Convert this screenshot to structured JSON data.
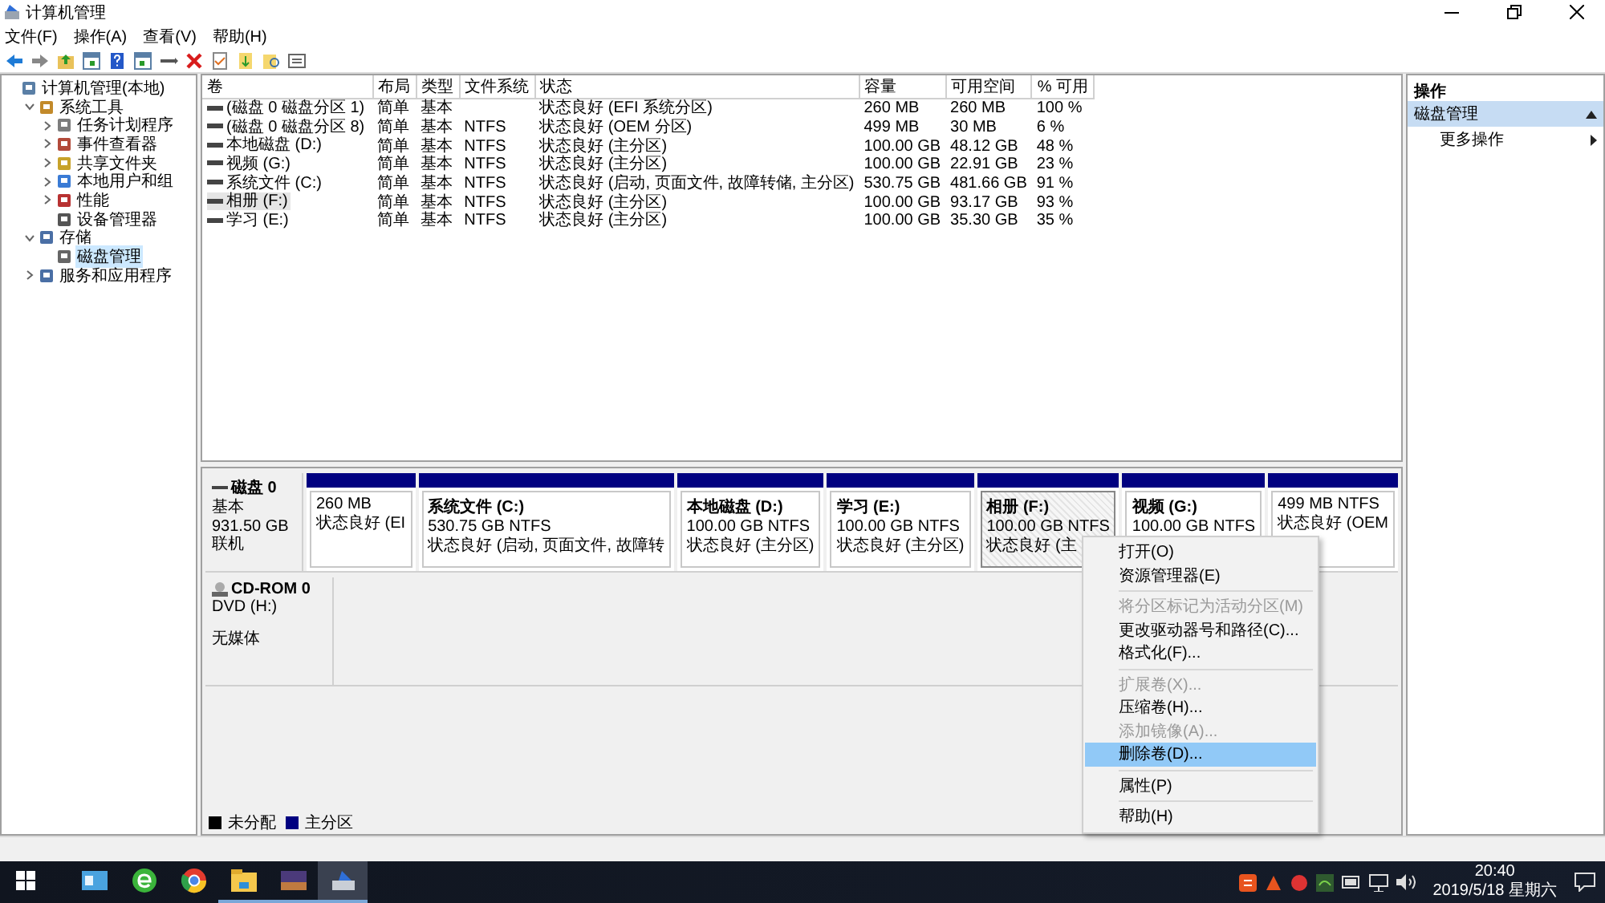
{
  "window": {
    "title": "计算机管理"
  },
  "menu_bar": [
    "文件(F)",
    "操作(A)",
    "查看(V)",
    "帮助(H)"
  ],
  "tree": [
    {
      "label": "计算机管理(本地)",
      "selected": false,
      "children": [
        {
          "label": "系统工具",
          "selected": false,
          "expanded": true,
          "children": [
            {
              "label": "任务计划程序",
              "selected": false,
              "expanded": false
            },
            {
              "label": "事件查看器",
              "selected": false,
              "expanded": false
            },
            {
              "label": "共享文件夹",
              "selected": false,
              "expanded": false
            },
            {
              "label": "本地用户和组",
              "selected": false,
              "expanded": false
            },
            {
              "label": "性能",
              "selected": false,
              "expanded": false
            },
            {
              "label": "设备管理器",
              "selected": false
            }
          ]
        },
        {
          "label": "存储",
          "selected": false,
          "expanded": true,
          "children": [
            {
              "label": "磁盘管理",
              "selected": true
            }
          ]
        },
        {
          "label": "服务和应用程序",
          "selected": false,
          "expanded": false
        }
      ]
    }
  ],
  "volume_table": {
    "columns": [
      "卷",
      "布局",
      "类型",
      "文件系统",
      "状态",
      "容量",
      "可用空间",
      "% 可用"
    ],
    "rows": [
      {
        "selected": false,
        "cells": [
          "(磁盘 0 磁盘分区 1)",
          "简单",
          "基本",
          "",
          "状态良好 (EFI 系统分区)",
          "260 MB",
          "260 MB",
          "100 %"
        ]
      },
      {
        "selected": false,
        "cells": [
          "(磁盘 0 磁盘分区 8)",
          "简单",
          "基本",
          "NTFS",
          "状态良好 (OEM 分区)",
          "499 MB",
          "30 MB",
          "6 %"
        ]
      },
      {
        "selected": false,
        "cells": [
          "本地磁盘 (D:)",
          "简单",
          "基本",
          "NTFS",
          "状态良好 (主分区)",
          "100.00 GB",
          "48.12 GB",
          "48 %"
        ]
      },
      {
        "selected": false,
        "cells": [
          "视频 (G:)",
          "简单",
          "基本",
          "NTFS",
          "状态良好 (主分区)",
          "100.00 GB",
          "22.91 GB",
          "23 %"
        ]
      },
      {
        "selected": false,
        "cells": [
          "系统文件 (C:)",
          "简单",
          "基本",
          "NTFS",
          "状态良好 (启动, 页面文件, 故障转储, 主分区)",
          "530.75 GB",
          "481.66 GB",
          "91 %"
        ]
      },
      {
        "selected": true,
        "cells": [
          "相册 (F:)",
          "简单",
          "基本",
          "NTFS",
          "状态良好 (主分区)",
          "100.00 GB",
          "93.17 GB",
          "93 %"
        ]
      },
      {
        "selected": false,
        "cells": [
          "学习 (E:)",
          "简单",
          "基本",
          "NTFS",
          "状态良好 (主分区)",
          "100.00 GB",
          "35.30 GB",
          "35 %"
        ]
      }
    ]
  },
  "disks": [
    {
      "kind": "disk",
      "name": "磁盘 0",
      "lines": [
        "基本",
        "931.50 GB",
        "联机"
      ],
      "partitions": [
        {
          "selected": false,
          "lines": [
            "260 MB",
            "状态良好 (EI"
          ]
        },
        {
          "selected": false,
          "title": "系统文件  (C:)",
          "lines": [
            "530.75 GB NTFS",
            "状态良好 (启动, 页面文件, 故障转"
          ]
        },
        {
          "selected": false,
          "title": "本地磁盘  (D:)",
          "lines": [
            "100.00 GB NTFS",
            "状态良好 (主分区)"
          ]
        },
        {
          "selected": false,
          "title": "学习  (E:)",
          "lines": [
            "100.00 GB NTFS",
            "状态良好 (主分区)"
          ]
        },
        {
          "selected": true,
          "title": "相册  (F:)",
          "lines": [
            "100.00 GB NTFS",
            "状态良好 (主"
          ]
        },
        {
          "selected": false,
          "title": "视频  (G:)",
          "lines": [
            "100.00 GB NTFS"
          ]
        },
        {
          "selected": false,
          "lines": [
            "499 MB NTFS",
            "状态良好 (OEM"
          ]
        }
      ]
    },
    {
      "kind": "cdrom",
      "name": "CD-ROM 0",
      "lines": [
        "DVD (H:)",
        "无媒体"
      ]
    }
  ],
  "legend": [
    {
      "label": "未分配",
      "color": "#000000"
    },
    {
      "label": "主分区",
      "color": "#000080"
    }
  ],
  "actions": {
    "title": "操作",
    "section": {
      "label": "磁盘管理",
      "expanded": true
    },
    "items": [
      "更多操作"
    ]
  },
  "context_menu": {
    "groups": [
      [
        {
          "label": "打开(O)",
          "disabled": false,
          "selected": false
        },
        {
          "label": "资源管理器(E)",
          "disabled": false,
          "selected": false
        }
      ],
      [
        {
          "label": "将分区标记为活动分区(M)",
          "disabled": true,
          "selected": false
        },
        {
          "label": "更改驱动器号和路径(C)...",
          "disabled": false,
          "selected": false
        },
        {
          "label": "格式化(F)...",
          "disabled": false,
          "selected": false
        }
      ],
      [
        {
          "label": "扩展卷(X)...",
          "disabled": true,
          "selected": false
        },
        {
          "label": "压缩卷(H)...",
          "disabled": false,
          "selected": false
        },
        {
          "label": "添加镜像(A)...",
          "disabled": true,
          "selected": false
        },
        {
          "label": "删除卷(D)...",
          "disabled": false,
          "selected": true
        }
      ],
      [
        {
          "label": "属性(P)",
          "disabled": false,
          "selected": false
        }
      ],
      [
        {
          "label": "帮助(H)",
          "disabled": false,
          "selected": false
        }
      ]
    ]
  },
  "taskbar": {
    "apps": [
      {
        "kind": "card",
        "running": false,
        "active": false
      },
      {
        "kind": "globe",
        "running": false,
        "active": false
      },
      {
        "kind": "browser",
        "running": false,
        "active": false
      },
      {
        "kind": "folder",
        "running": true,
        "active": false
      },
      {
        "kind": "photo",
        "running": true,
        "active": false
      },
      {
        "kind": "disk",
        "running": true,
        "active": true
      }
    ],
    "time": "20:40",
    "date": "2019/5/18 星期六"
  }
}
